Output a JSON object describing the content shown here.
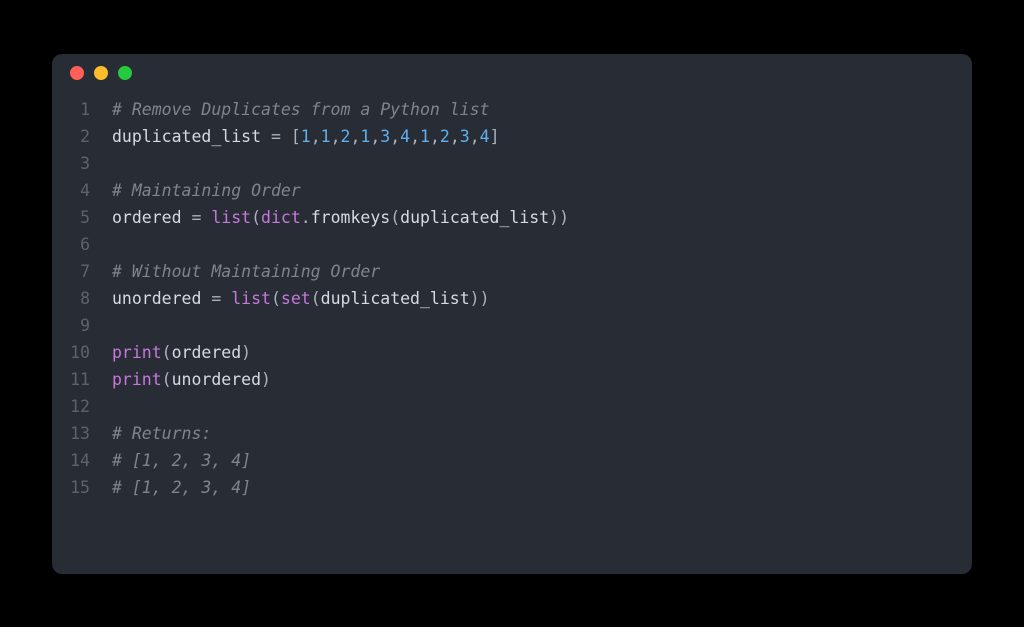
{
  "window": {
    "traffic_lights": [
      "close",
      "minimize",
      "zoom"
    ]
  },
  "code": {
    "lines": [
      {
        "num": "1",
        "tokens": [
          {
            "cls": "tok-comment",
            "t": "# Remove Duplicates from a Python list"
          }
        ]
      },
      {
        "num": "2",
        "tokens": [
          {
            "cls": "tok-default",
            "t": "duplicated_list"
          },
          {
            "cls": "tok-operator",
            "t": " = "
          },
          {
            "cls": "tok-punct",
            "t": "["
          },
          {
            "cls": "tok-number",
            "t": "1"
          },
          {
            "cls": "tok-punct",
            "t": ","
          },
          {
            "cls": "tok-number",
            "t": "1"
          },
          {
            "cls": "tok-punct",
            "t": ","
          },
          {
            "cls": "tok-number",
            "t": "2"
          },
          {
            "cls": "tok-punct",
            "t": ","
          },
          {
            "cls": "tok-number",
            "t": "1"
          },
          {
            "cls": "tok-punct",
            "t": ","
          },
          {
            "cls": "tok-number",
            "t": "3"
          },
          {
            "cls": "tok-punct",
            "t": ","
          },
          {
            "cls": "tok-number",
            "t": "4"
          },
          {
            "cls": "tok-punct",
            "t": ","
          },
          {
            "cls": "tok-number",
            "t": "1"
          },
          {
            "cls": "tok-punct",
            "t": ","
          },
          {
            "cls": "tok-number",
            "t": "2"
          },
          {
            "cls": "tok-punct",
            "t": ","
          },
          {
            "cls": "tok-number",
            "t": "3"
          },
          {
            "cls": "tok-punct",
            "t": ","
          },
          {
            "cls": "tok-number",
            "t": "4"
          },
          {
            "cls": "tok-punct",
            "t": "]"
          }
        ]
      },
      {
        "num": "3",
        "tokens": []
      },
      {
        "num": "4",
        "tokens": [
          {
            "cls": "tok-comment",
            "t": "# Maintaining Order"
          }
        ]
      },
      {
        "num": "5",
        "tokens": [
          {
            "cls": "tok-default",
            "t": "ordered"
          },
          {
            "cls": "tok-operator",
            "t": " = "
          },
          {
            "cls": "tok-builtin",
            "t": "list"
          },
          {
            "cls": "tok-punct",
            "t": "("
          },
          {
            "cls": "tok-builtin",
            "t": "dict"
          },
          {
            "cls": "tok-punct",
            "t": "."
          },
          {
            "cls": "tok-default",
            "t": "fromkeys"
          },
          {
            "cls": "tok-punct",
            "t": "("
          },
          {
            "cls": "tok-default",
            "t": "duplicated_list"
          },
          {
            "cls": "tok-punct",
            "t": "))"
          }
        ]
      },
      {
        "num": "6",
        "tokens": []
      },
      {
        "num": "7",
        "tokens": [
          {
            "cls": "tok-comment",
            "t": "# Without Maintaining Order"
          }
        ]
      },
      {
        "num": "8",
        "tokens": [
          {
            "cls": "tok-default",
            "t": "unordered"
          },
          {
            "cls": "tok-operator",
            "t": " = "
          },
          {
            "cls": "tok-builtin",
            "t": "list"
          },
          {
            "cls": "tok-punct",
            "t": "("
          },
          {
            "cls": "tok-builtin",
            "t": "set"
          },
          {
            "cls": "tok-punct",
            "t": "("
          },
          {
            "cls": "tok-default",
            "t": "duplicated_list"
          },
          {
            "cls": "tok-punct",
            "t": "))"
          }
        ]
      },
      {
        "num": "9",
        "tokens": []
      },
      {
        "num": "10",
        "tokens": [
          {
            "cls": "tok-builtin",
            "t": "print"
          },
          {
            "cls": "tok-punct",
            "t": "("
          },
          {
            "cls": "tok-default",
            "t": "ordered"
          },
          {
            "cls": "tok-punct",
            "t": ")"
          }
        ]
      },
      {
        "num": "11",
        "tokens": [
          {
            "cls": "tok-builtin",
            "t": "print"
          },
          {
            "cls": "tok-punct",
            "t": "("
          },
          {
            "cls": "tok-default",
            "t": "unordered"
          },
          {
            "cls": "tok-punct",
            "t": ")"
          }
        ]
      },
      {
        "num": "12",
        "tokens": []
      },
      {
        "num": "13",
        "tokens": [
          {
            "cls": "tok-comment",
            "t": "# Returns:"
          }
        ]
      },
      {
        "num": "14",
        "tokens": [
          {
            "cls": "tok-comment",
            "t": "# [1, 2, 3, 4]"
          }
        ]
      },
      {
        "num": "15",
        "tokens": [
          {
            "cls": "tok-comment",
            "t": "# [1, 2, 3, 4]"
          }
        ]
      }
    ]
  }
}
